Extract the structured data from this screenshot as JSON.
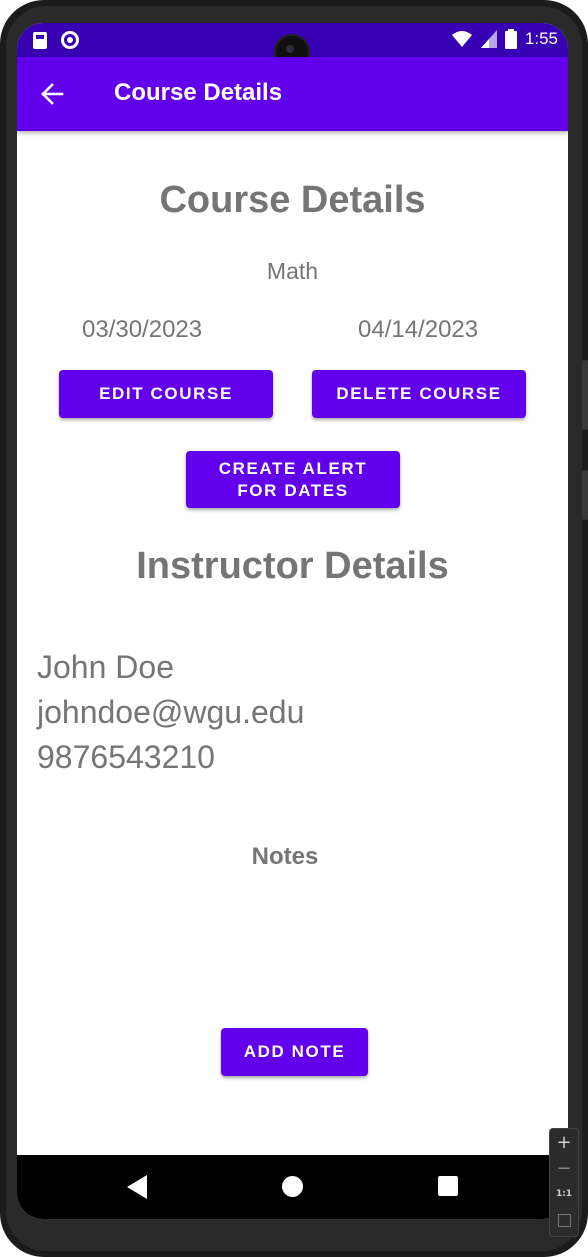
{
  "status_bar": {
    "time": "1:55",
    "left_icons": [
      "sd-card-icon",
      "circle-notification-icon"
    ],
    "right_icons": [
      "wifi-icon",
      "signal-icon",
      "battery-icon"
    ]
  },
  "app_bar": {
    "back_icon": "arrow-back-icon",
    "title": "Course Details"
  },
  "course": {
    "heading": "Course Details",
    "title": "Math",
    "start_date": "03/30/2023",
    "end_date": "04/14/2023",
    "edit_label": "EDIT COURSE",
    "delete_label": "DELETE COURSE",
    "alert_label": "CREATE ALERT FOR DATES"
  },
  "instructor": {
    "heading": "Instructor Details",
    "name": "John Doe",
    "email": "johndoe@wgu.edu",
    "phone": "9876543210"
  },
  "notes": {
    "heading": "Notes",
    "add_label": "ADD NOTE"
  },
  "nav_bar": {
    "icons": [
      "nav-back-icon",
      "nav-home-icon",
      "nav-recents-icon"
    ]
  },
  "emulator_controls": {
    "zoom_in": "+",
    "zoom_out": "−",
    "actual_size": "1:1"
  },
  "colors": {
    "primary": "#6200ee",
    "primary_dark": "#3700b3",
    "text_gray": "#757575"
  }
}
